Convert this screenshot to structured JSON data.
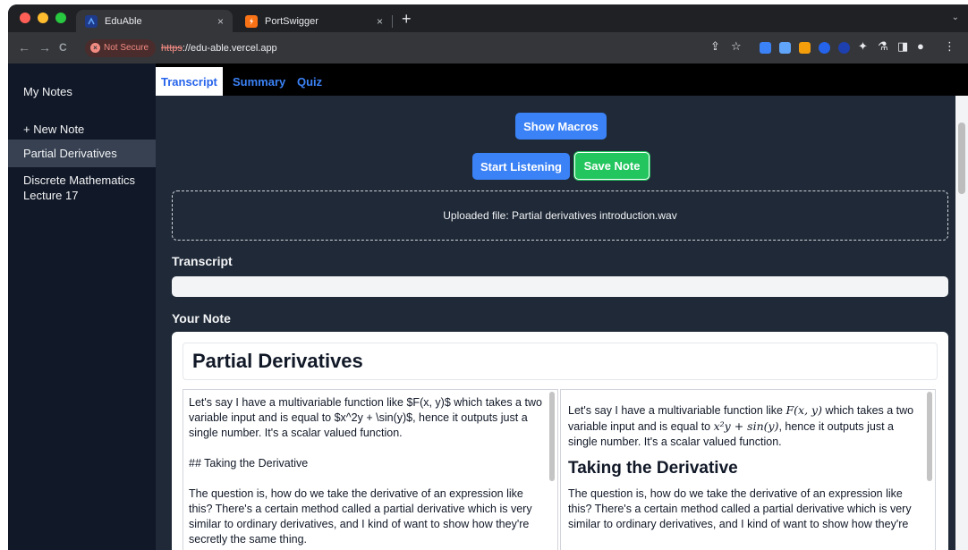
{
  "browser": {
    "tabs": [
      {
        "title": "EduAble",
        "close": "×"
      },
      {
        "title": "PortSwigger",
        "close": "×"
      }
    ],
    "new_tab": "+",
    "tab_menu": "⌄",
    "nav": {
      "back": "←",
      "forward": "→",
      "reload": "C"
    },
    "security_label": "Not Secure",
    "url_scheme": "https",
    "url_rest": "://edu-able.vercel.app",
    "icons": [
      "share-icon",
      "star-icon",
      "extension-icons",
      "puzzle-icon",
      "profile-icon",
      "menu-icon"
    ]
  },
  "sidebar": {
    "title": "My Notes",
    "items": [
      {
        "label": "+ New Note"
      },
      {
        "label": "Partial Derivatives",
        "active": true
      },
      {
        "label": "Discrete Mathematics Lecture 17"
      }
    ]
  },
  "main": {
    "tabs": [
      {
        "label": "Transcript",
        "active": true
      },
      {
        "label": "Summary"
      },
      {
        "label": "Quiz"
      }
    ],
    "show_macros": "Show Macros",
    "start_listening": "Start Listening",
    "save_note": "Save Note",
    "uploaded_file": "Uploaded file: Partial derivatives introduction.wav",
    "transcript_label": "Transcript",
    "transcript_value": "",
    "your_note_label": "Your Note",
    "note": {
      "title": "Partial Derivatives",
      "editor": {
        "p1": "Let's say I have a multivariable function like $F(x, y)$ which takes a two variable input and is equal to $x^2y + \\sin(y)$, hence it outputs just a single number. It's a scalar valued function.",
        "p2": "## Taking the Derivative",
        "p3": "The question is, how do we take the derivative of an expression like this? There's a certain method called a partial derivative which is very similar to ordinary derivatives, and I kind of want to show how they're secretly the same thing."
      },
      "preview": {
        "p1_a": "Let's say I have a multivariable function like ",
        "p1_math1": "F(x, y)",
        "p1_b": " which takes a two variable input and is equal to ",
        "p1_math2": "x²y + sin(y)",
        "p1_c": ", hence it outputs just a single number. It's a scalar valued function.",
        "heading": "Taking the Derivative",
        "p2": "The question is, how do we take the derivative of an expression like this? There's a certain method called a partial derivative which is very similar to ordinary derivatives, and I kind of want to show how they're"
      }
    }
  },
  "colors": {
    "sidebar_bg": "#111827",
    "main_bg": "#1f2937",
    "accent_blue": "#3b82f6",
    "accent_green": "#22c55e"
  }
}
